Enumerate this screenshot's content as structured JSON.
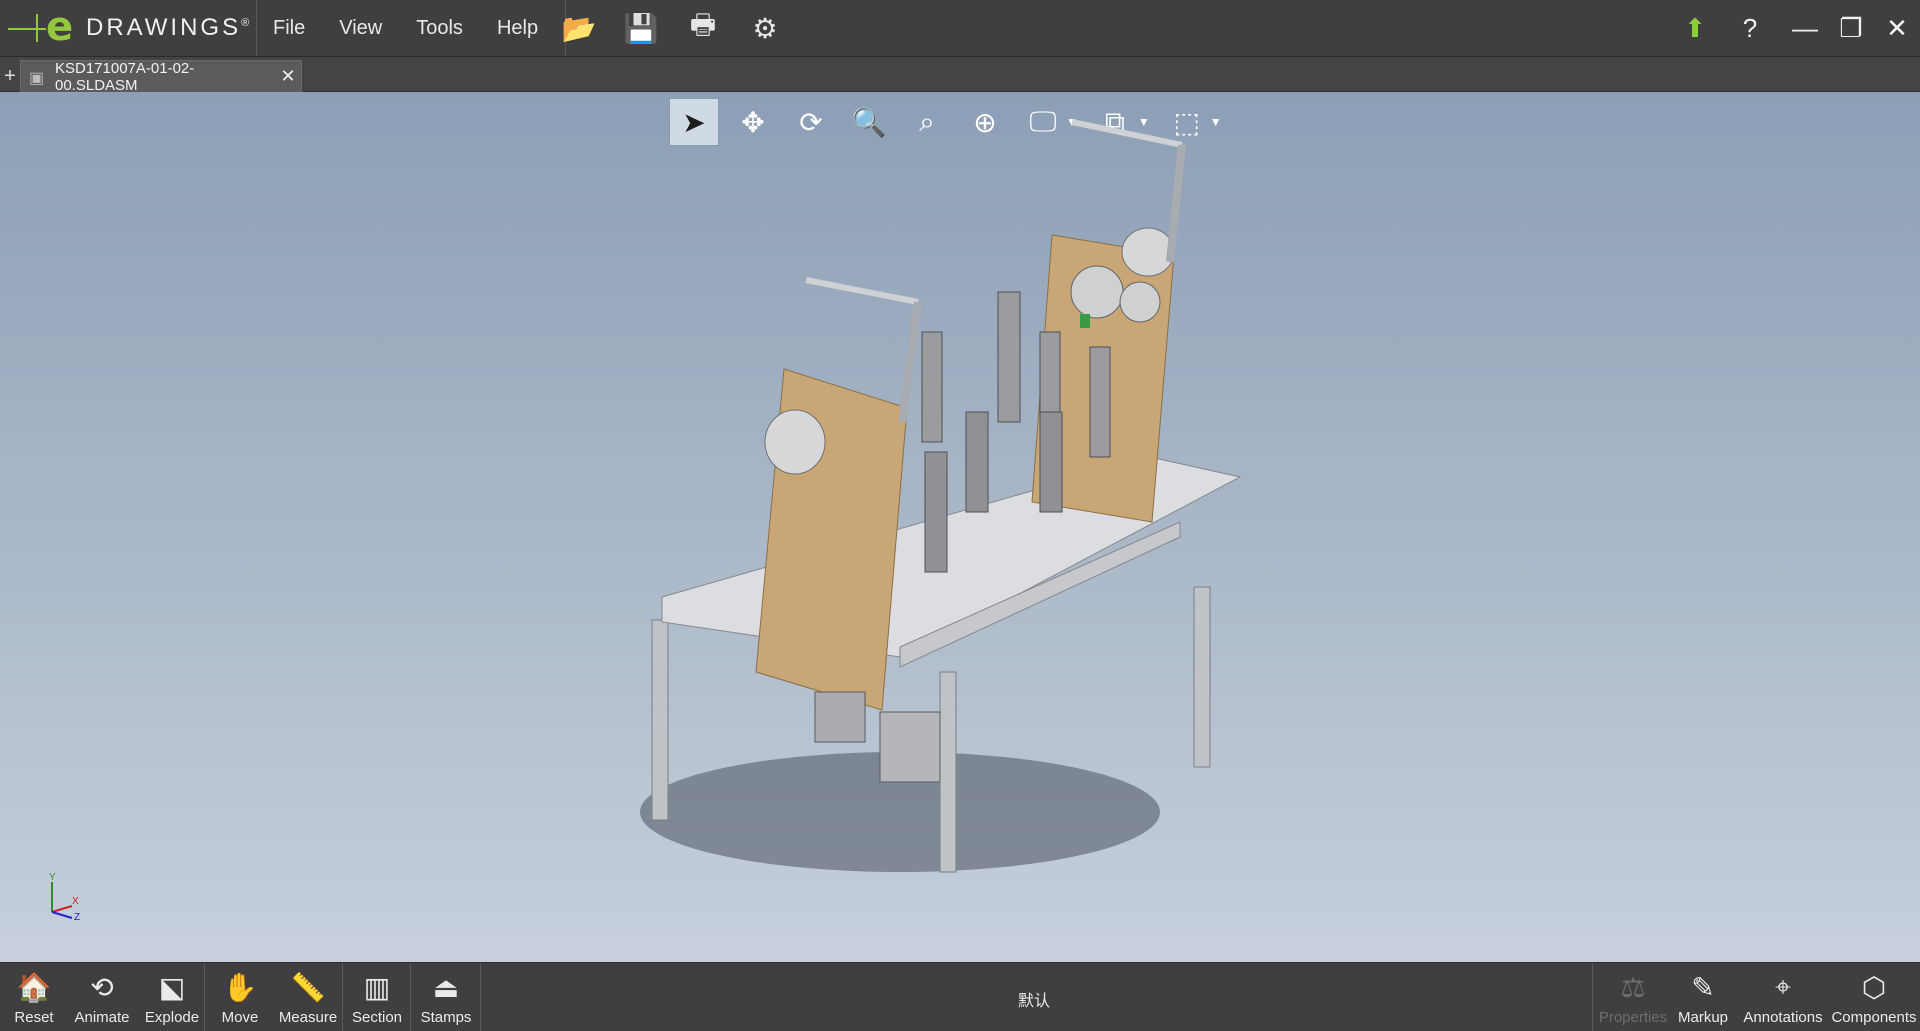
{
  "app": {
    "logo_e": "e",
    "logo_word": "DRAWINGS",
    "logo_reg": "®"
  },
  "menu": {
    "file": "File",
    "view": "View",
    "tools": "Tools",
    "help": "Help"
  },
  "quick_tools": [
    {
      "name": "open-file-icon",
      "glyph": "📂"
    },
    {
      "name": "save-icon",
      "glyph": "💾"
    },
    {
      "name": "print-icon",
      "glyph": "🖶"
    },
    {
      "name": "settings-gear-icon",
      "glyph": "⚙"
    }
  ],
  "window_controls": {
    "upload": "⬆",
    "help": "?",
    "minimize": "—",
    "restore": "❐",
    "close": "✕"
  },
  "tab": {
    "add": "+",
    "title": "KSD171007A-01-02-00.SLDASM",
    "close": "✕"
  },
  "view_toolbar": [
    {
      "name": "select-arrow-icon",
      "glyph": "➤",
      "selected": true,
      "dropdown": false
    },
    {
      "name": "pan-move-icon",
      "glyph": "✥",
      "selected": false,
      "dropdown": false
    },
    {
      "name": "rotate-icon",
      "glyph": "⟳",
      "selected": false,
      "dropdown": false
    },
    {
      "name": "zoom-in-out-icon",
      "glyph": "🔍",
      "selected": false,
      "dropdown": false
    },
    {
      "name": "zoom-to-area-icon",
      "glyph": "⌕",
      "selected": false,
      "dropdown": false
    },
    {
      "name": "zoom-to-fit-icon",
      "glyph": "⊕",
      "selected": false,
      "dropdown": false
    },
    {
      "name": "display-style-icon",
      "glyph": "🖵",
      "selected": false,
      "dropdown": true
    },
    {
      "name": "view-orientation-icon",
      "glyph": "⧉",
      "selected": false,
      "dropdown": true
    },
    {
      "name": "standard-views-cube-icon",
      "glyph": "⬚",
      "selected": false,
      "dropdown": true
    }
  ],
  "triad": {
    "y": "Y",
    "x": "X",
    "z": "Z"
  },
  "bottom_left": [
    {
      "name": "reset-button",
      "icon": "reset-home-icon",
      "glyph": "🏠",
      "label": "Reset"
    },
    {
      "name": "animate-button",
      "icon": "animate-icon",
      "glyph": "⟲",
      "label": "Animate"
    },
    {
      "name": "explode-button",
      "icon": "explode-icon",
      "glyph": "⬕",
      "label": "Explode"
    },
    {
      "name": "move-button",
      "icon": "move-icon",
      "glyph": "✋",
      "label": "Move"
    },
    {
      "name": "measure-button",
      "icon": "measure-icon",
      "glyph": "📏",
      "label": "Measure"
    },
    {
      "name": "section-button",
      "icon": "section-icon",
      "glyph": "▥",
      "label": "Section"
    },
    {
      "name": "stamps-button",
      "icon": "stamps-icon",
      "glyph": "⏏",
      "label": "Stamps"
    }
  ],
  "configuration": "默认",
  "bottom_right": [
    {
      "name": "properties-button",
      "icon": "properties-scale-icon",
      "glyph": "⚖",
      "label": "Properties",
      "disabled": true
    },
    {
      "name": "markup-button",
      "icon": "markup-pencil-icon",
      "glyph": "✎",
      "label": "Markup",
      "disabled": false
    },
    {
      "name": "annotations-button",
      "icon": "annotations-icon",
      "glyph": "⌖",
      "label": "Annotations",
      "disabled": false
    },
    {
      "name": "components-button",
      "icon": "components-cube-icon",
      "glyph": "⬡",
      "label": "Components",
      "disabled": false
    }
  ],
  "colors": {
    "brand_green": "#93c83e",
    "plate": "#c9a676",
    "frame": "#d9dadc",
    "background_top": "#8c9fb6",
    "background_bottom": "#c7d0dc"
  }
}
